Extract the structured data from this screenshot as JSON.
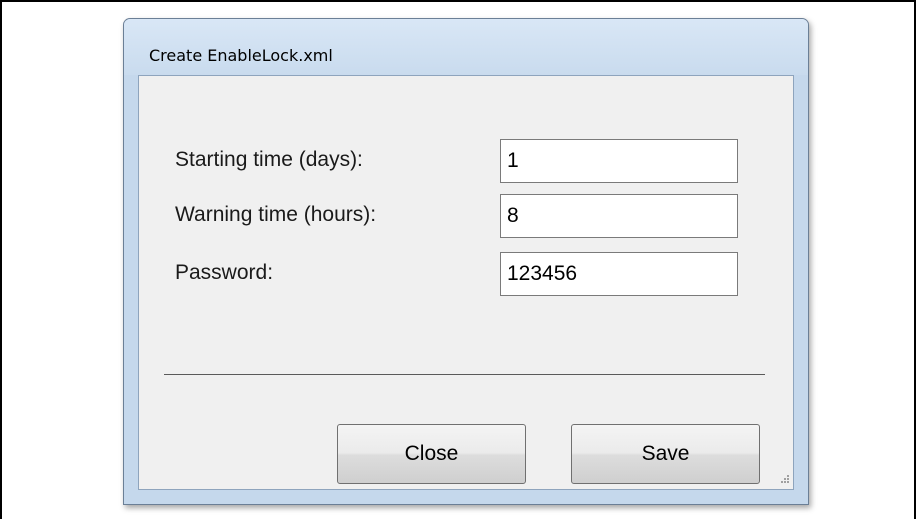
{
  "window": {
    "title": "Create EnableLock.xml"
  },
  "form": {
    "starting_time": {
      "label": "Starting time (days):",
      "value": "1"
    },
    "warning_time": {
      "label": "Warning time (hours):",
      "value": "8"
    },
    "password": {
      "label": "Password:",
      "value": "123456"
    }
  },
  "buttons": {
    "close_label": "Close",
    "save_label": "Save"
  },
  "icons": {
    "resize_grip": "resize-grip-icon"
  }
}
